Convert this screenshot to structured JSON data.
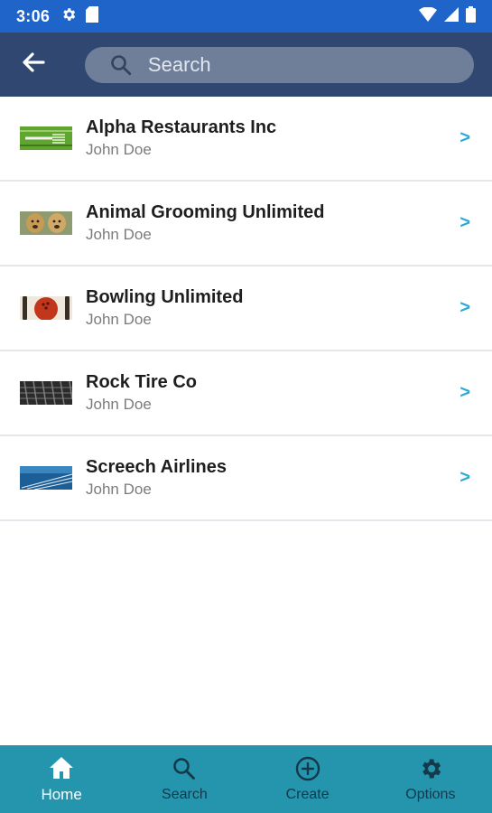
{
  "status_bar": {
    "time": "3:06",
    "left_icons": [
      "gear-icon",
      "sd-card-icon"
    ],
    "right_icons": [
      "wifi-icon",
      "cellular-signal-icon",
      "battery-icon"
    ]
  },
  "header": {
    "back_icon": "arrow-left-icon",
    "search_placeholder": "Search",
    "search_icon": "search-icon"
  },
  "list": {
    "items": [
      {
        "title": "Alpha Restaurants Inc",
        "subtitle": "John Doe",
        "thumbnail": "fork-green"
      },
      {
        "title": "Animal Grooming Unlimited",
        "subtitle": "John Doe",
        "thumbnail": "dogs"
      },
      {
        "title": "Bowling Unlimited",
        "subtitle": "John Doe",
        "thumbnail": "bowling-ball"
      },
      {
        "title": "Rock Tire Co",
        "subtitle": "John Doe",
        "thumbnail": "tire-tread"
      },
      {
        "title": "Screech Airlines",
        "subtitle": "John Doe",
        "thumbnail": "runway"
      }
    ],
    "chevron": ">"
  },
  "bottom_nav": {
    "items": [
      {
        "label": "Home",
        "icon": "home-icon",
        "active": true
      },
      {
        "label": "Search",
        "icon": "search-icon",
        "active": false
      },
      {
        "label": "Create",
        "icon": "plus-circle-icon",
        "active": false
      },
      {
        "label": "Options",
        "icon": "gear-icon",
        "active": false
      }
    ]
  },
  "colors": {
    "status_bar": "#1f64c8",
    "header": "#2f4771",
    "search_box": "#6f7f99",
    "bottom_nav": "#2594ad",
    "chevron": "#2aa8d6"
  }
}
